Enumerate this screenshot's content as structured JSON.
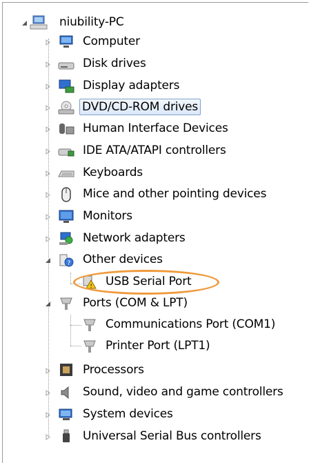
{
  "tree": {
    "root": {
      "label": "niubility-PC",
      "icon": "computer-network-icon"
    },
    "categories": [
      {
        "label": "Computer",
        "icon": "computer-icon"
      },
      {
        "label": "Disk drives",
        "icon": "disk-drive-icon"
      },
      {
        "label": "Display adapters",
        "icon": "display-adapter-icon"
      },
      {
        "label": "DVD/CD-ROM drives",
        "icon": "dvd-drive-icon"
      },
      {
        "label": "Human Interface Devices",
        "icon": "hid-icon"
      },
      {
        "label": "IDE ATA/ATAPI controllers",
        "icon": "ide-controller-icon"
      },
      {
        "label": "Keyboards",
        "icon": "keyboard-icon"
      },
      {
        "label": "Mice and other pointing devices",
        "icon": "mouse-icon"
      },
      {
        "label": "Monitors",
        "icon": "monitor-icon"
      },
      {
        "label": "Network adapters",
        "icon": "network-adapter-icon"
      },
      {
        "label": "Other devices",
        "icon": "unknown-device-icon"
      },
      {
        "label": "USB Serial Port",
        "icon": "warning-device-icon"
      },
      {
        "label": "Ports (COM & LPT)",
        "icon": "port-icon"
      },
      {
        "label": "Communications Port (COM1)",
        "icon": "port-icon"
      },
      {
        "label": "Printer Port (LPT1)",
        "icon": "port-icon"
      },
      {
        "label": "Processors",
        "icon": "processor-icon"
      },
      {
        "label": "Sound, video and game controllers",
        "icon": "speaker-icon"
      },
      {
        "label": "System devices",
        "icon": "system-device-icon"
      },
      {
        "label": "Universal Serial Bus controllers",
        "icon": "usb-icon"
      }
    ]
  },
  "colors": {
    "selection_border": "#7da2ce",
    "highlight_ring": "#ef9a3c",
    "expander": "#595959"
  }
}
